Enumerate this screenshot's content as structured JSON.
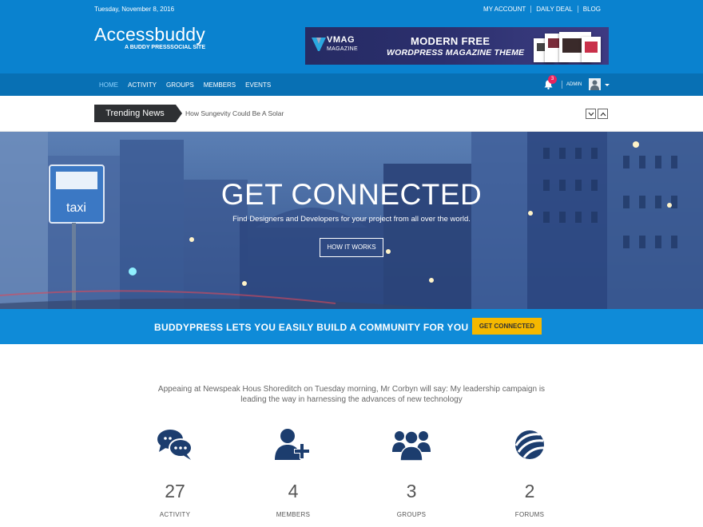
{
  "topbar": {
    "date": "Tuesday, November 8, 2016",
    "links": [
      "MY ACCOUNT",
      "DAILY DEAL",
      "BLOG"
    ]
  },
  "logo": {
    "name": "Accessbuddy",
    "tagline": "A BUDDY PRESSSOCIAL SITE"
  },
  "banner": {
    "brand": "VMAG",
    "brand_sub": "MAGAZINE",
    "headline1": "MODERN FREE",
    "headline2": "WORDPRESS MAGAZINE THEME"
  },
  "nav": {
    "items": [
      "HOME",
      "ACTIVITY",
      "GROUPS",
      "MEMBERS",
      "EVENTS"
    ],
    "notification_count": "3",
    "user": "ADMIN"
  },
  "trending": {
    "label": "Trending News",
    "headline": "How Sungevity Could Be A Solar"
  },
  "hero": {
    "title": "GET CONNECTED",
    "subtitle": "Find Designers and Developers for your project from all over the world.",
    "button": "HOW IT WORKS"
  },
  "cta": {
    "text": "BUDDYPRESS LETS YOU EASILY BUILD A COMMUNITY FOR YOU",
    "button": "GET CONNECTED"
  },
  "intro": "Appeaing at Newspeak Hous Shoreditch on Tuesday morning, Mr Corbyn will say: My leadership campaign is leading the way in harnessing the advances of new technology",
  "stats": [
    {
      "icon": "chat-bubbles-icon",
      "value": "27",
      "label": "ACTIVITY"
    },
    {
      "icon": "add-user-icon",
      "value": "4",
      "label": "MEMBERS"
    },
    {
      "icon": "group-icon",
      "value": "3",
      "label": "GROUPS"
    },
    {
      "icon": "forum-icon",
      "value": "2",
      "label": "FORUMS"
    }
  ],
  "colors": {
    "topbar": "#0a82cf",
    "nav": "#0870b4",
    "cta": "#0f8bd8",
    "cta_button": "#f5b800",
    "icon": "#1c3d6e"
  }
}
